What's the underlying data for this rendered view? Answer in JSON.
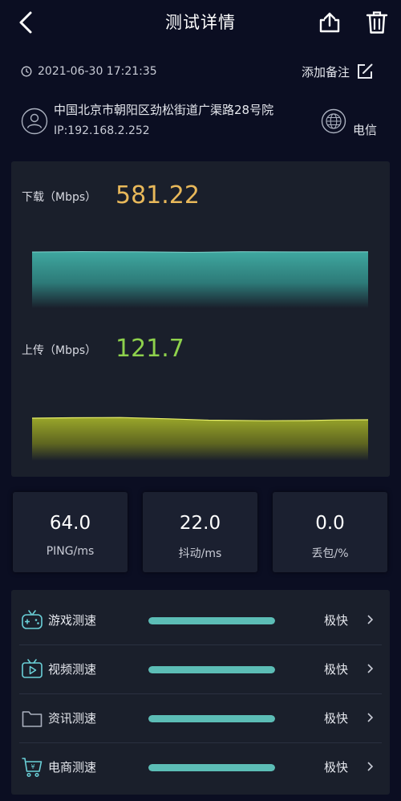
{
  "header": {
    "title": "测试详情"
  },
  "meta": {
    "timestamp": "2021-06-30 17:21:35",
    "note_label": "添加备注",
    "address": "中国北京市朝阳区劲松街道广渠路28号院",
    "ip": "IP:192.168.2.252",
    "isp": "电信"
  },
  "speed": {
    "download_label": "下载（Mbps）",
    "download_value": "581.22",
    "upload_label": "上传（Mbps）",
    "upload_value": "121.7"
  },
  "stats": [
    {
      "value": "64.0",
      "label": "PING/ms"
    },
    {
      "value": "22.0",
      "label": "抖动/ms"
    },
    {
      "value": "0.0",
      "label": "丢包/%"
    }
  ],
  "tests": [
    {
      "label": "游戏测速",
      "rating": "极快",
      "level": 1.0,
      "icon": "gamepad-icon"
    },
    {
      "label": "视频测速",
      "rating": "极快",
      "level": 1.0,
      "icon": "video-icon"
    },
    {
      "label": "资讯测速",
      "rating": "极快",
      "level": 1.0,
      "icon": "folder-icon"
    },
    {
      "label": "电商测速",
      "rating": "极快",
      "level": 1.0,
      "icon": "cart-icon"
    }
  ],
  "colors": {
    "background": "#0b0e22",
    "panel": "#1a1f2b",
    "download_accent": "#e8b85a",
    "upload_accent": "#8ed14c",
    "download_wave": "#3a9e98",
    "upload_wave": "#8e9a1e",
    "progress": "#5cbdb6",
    "icon_accent": "#6ad0d8"
  }
}
